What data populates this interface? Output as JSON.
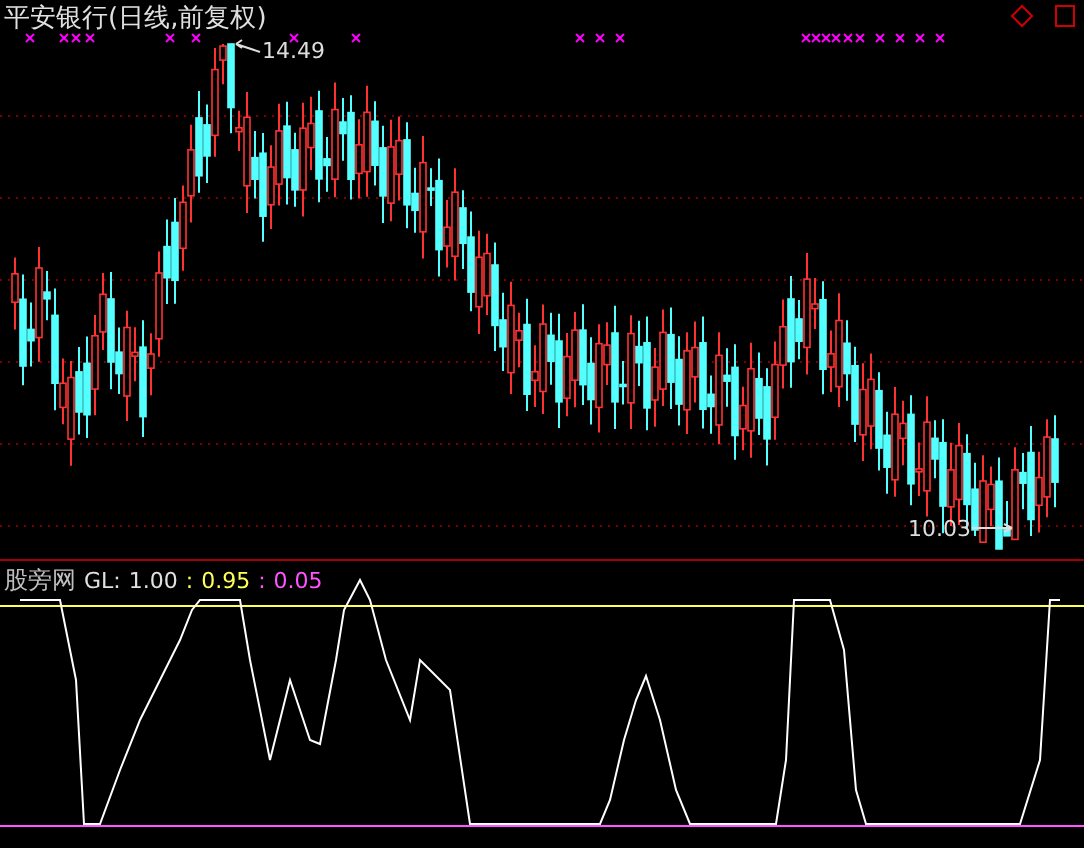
{
  "price_pane": {
    "title": "平安银行(日线,前复权)",
    "high_label": "14.49",
    "low_label": "10.03"
  },
  "indicator_pane": {
    "name": "股旁网",
    "label": "GL:",
    "values": [
      {
        "text": "1.00",
        "color": "#e0e0e0"
      },
      {
        "separator": ":",
        "text": "0.95",
        "color": "#ffff54"
      },
      {
        "separator": ":",
        "text": "0.05",
        "color": "#ff54ff"
      }
    ]
  }
}
